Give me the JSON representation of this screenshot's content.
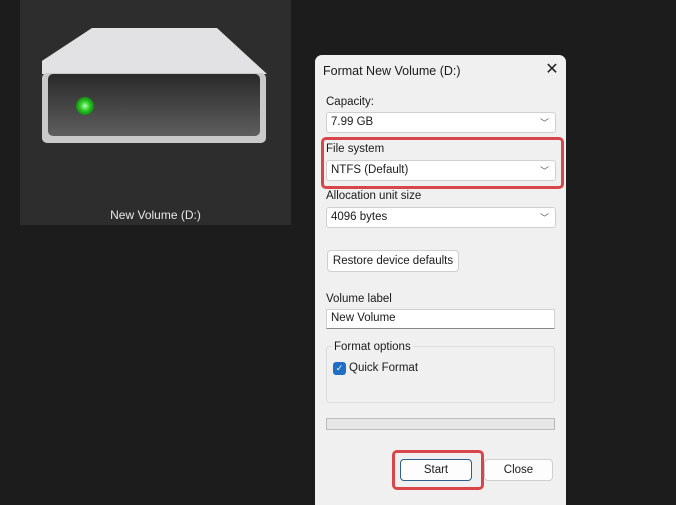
{
  "drive": {
    "label": "New Volume (D:)"
  },
  "dialog": {
    "title": "Format New Volume (D:)",
    "close_icon": "✕",
    "capacity": {
      "label": "Capacity:",
      "value": "7.99 GB"
    },
    "file_system": {
      "label": "File system",
      "value": "NTFS (Default)"
    },
    "allocation": {
      "label": "Allocation unit size",
      "value": "4096 bytes"
    },
    "restore_label": "Restore device defaults",
    "volume_label": {
      "label": "Volume label",
      "value": "New Volume"
    },
    "format_options": {
      "label": "Format options",
      "quick_format": "Quick Format",
      "quick_format_checked": true
    },
    "progress": 0,
    "start_label": "Start",
    "close_label": "Close"
  },
  "colors": {
    "highlight": "#d9464a",
    "accent": "#1f6fc5"
  }
}
